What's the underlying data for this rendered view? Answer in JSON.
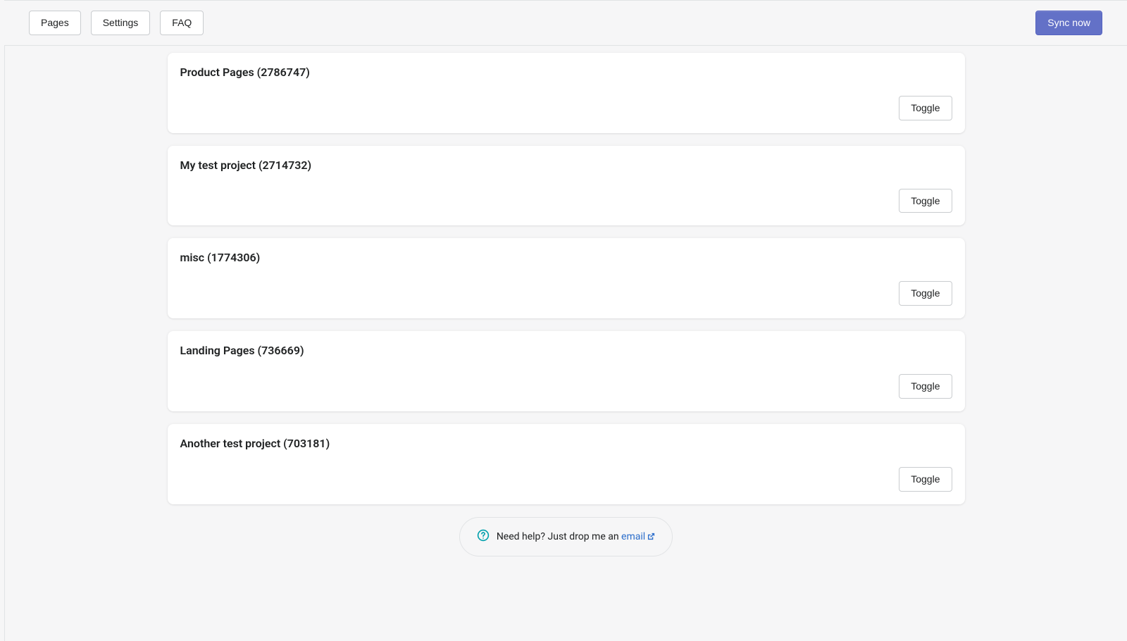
{
  "topbar": {
    "pages_label": "Pages",
    "settings_label": "Settings",
    "faq_label": "FAQ",
    "sync_label": "Sync now"
  },
  "projects": [
    {
      "title": "Product Pages (2786747)",
      "toggle_label": "Toggle"
    },
    {
      "title": "My test project (2714732)",
      "toggle_label": "Toggle"
    },
    {
      "title": "misc (1774306)",
      "toggle_label": "Toggle"
    },
    {
      "title": "Landing Pages (736669)",
      "toggle_label": "Toggle"
    },
    {
      "title": "Another test project (703181)",
      "toggle_label": "Toggle"
    }
  ],
  "help": {
    "text_prefix": "Need help? Just drop me an ",
    "link_label": "email"
  }
}
